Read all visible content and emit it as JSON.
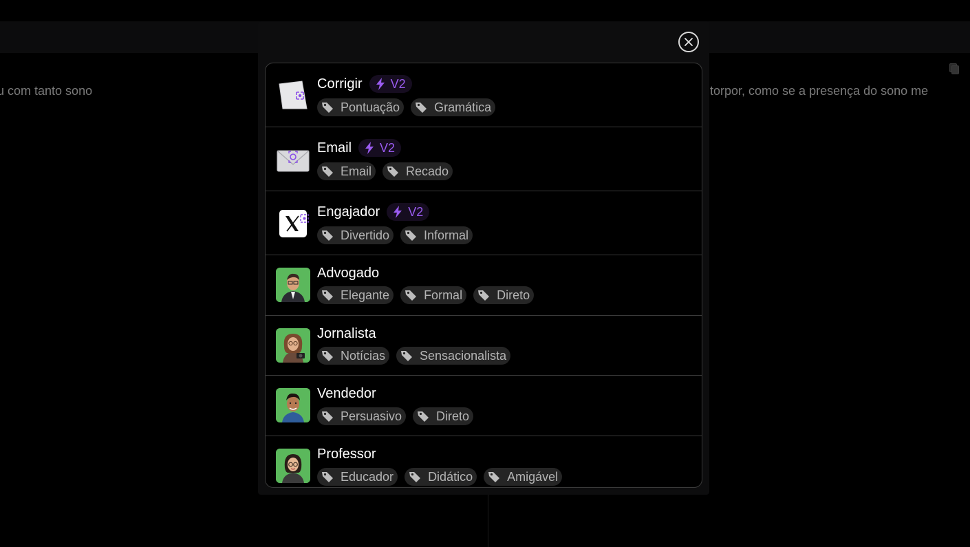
{
  "background": {
    "left_text": "u com tanto sono",
    "right_text": "torpor, como se a presença do sono me"
  },
  "modal": {
    "items": [
      {
        "name": "Corrigir",
        "badge": "V2",
        "tags": [
          "Pontuação",
          "Gramática"
        ],
        "icon": "paper-note-icon"
      },
      {
        "name": "Email",
        "badge": "V2",
        "tags": [
          "Email",
          "Recado"
        ],
        "icon": "envelope-icon"
      },
      {
        "name": "Engajador",
        "badge": "V2",
        "tags": [
          "Divertido",
          "Informal"
        ],
        "icon": "x-logo-icon"
      },
      {
        "name": "Advogado",
        "tags": [
          "Elegante",
          "Formal",
          "Direto"
        ],
        "icon": "lawyer-avatar"
      },
      {
        "name": "Jornalista",
        "tags": [
          "Notícias",
          "Sensacionalista"
        ],
        "icon": "journalist-avatar"
      },
      {
        "name": "Vendedor",
        "tags": [
          "Persuasivo",
          "Direto"
        ],
        "icon": "seller-avatar"
      },
      {
        "name": "Professor",
        "tags": [
          "Educador",
          "Didático",
          "Amigável"
        ],
        "icon": "teacher-avatar"
      }
    ]
  },
  "colors": {
    "accent": "#9a5bf0",
    "tag_bg": "#252525",
    "avatar_bg": "#4caf50"
  }
}
